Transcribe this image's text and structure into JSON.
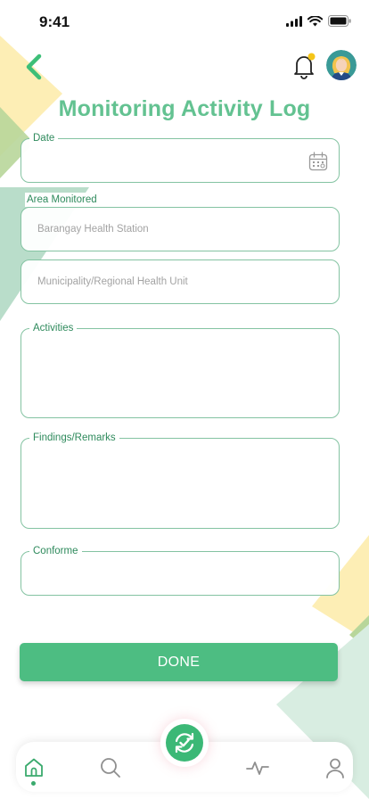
{
  "status_bar": {
    "time": "9:41"
  },
  "header": {
    "title": "Monitoring Activity Log"
  },
  "form": {
    "date": {
      "label": "Date",
      "value": ""
    },
    "area_label": "Area Monitored",
    "barangay": {
      "placeholder": "Barangay Health Station",
      "value": ""
    },
    "municipality": {
      "placeholder": "Municipality/Regional Health Unit",
      "value": ""
    },
    "activities": {
      "label": "Activities",
      "value": ""
    },
    "findings": {
      "label": "Findings/Remarks",
      "value": ""
    },
    "conforme": {
      "label": "Conforme",
      "value": ""
    }
  },
  "done_button": {
    "label": "DONE"
  },
  "bottom_nav": {
    "items": [
      {
        "icon": "home-icon",
        "active": true
      },
      {
        "icon": "search-icon",
        "active": false
      },
      {
        "icon": "check-icon",
        "active": false
      },
      {
        "icon": "activity-icon",
        "active": false
      },
      {
        "icon": "user-icon",
        "active": false
      }
    ]
  },
  "colors": {
    "accent": "#4dbd82",
    "title": "#63c291",
    "label": "#2e8a5c",
    "border": "#84c3a2",
    "deco_yellow": "#fdeeb5",
    "deco_green": "#a8d4bd",
    "notification_dot": "#f5c518"
  }
}
